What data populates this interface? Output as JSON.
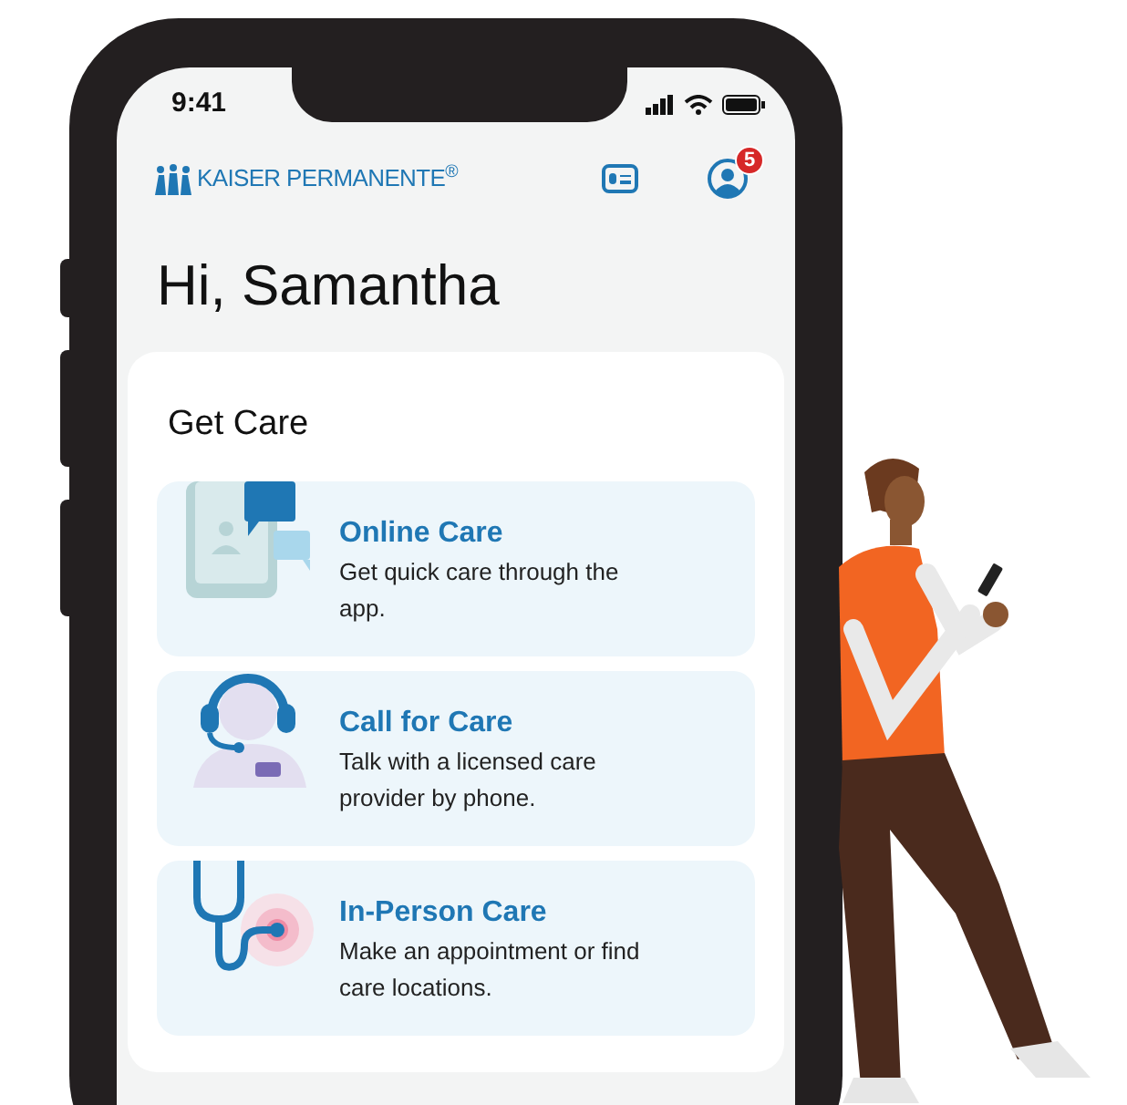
{
  "status_bar": {
    "time": "9:41"
  },
  "header": {
    "logo": "KAISER PERMANENTE$^{®}$",
    "notification_count": "5"
  },
  "greeting": "Hi, Samantha",
  "get_care": {
    "title": "Get Care",
    "items": [
      {
        "kind": "online",
        "title": "Online Care",
        "description": "Get quick care through the app."
      },
      {
        "kind": "call",
        "title": "Call for Care",
        "description": "Talk with a licensed care provider by phone."
      },
      {
        "kind": "in_person",
        "title": "In-Person Care",
        "description": "Make an appointment or find care locations."
      }
    ]
  }
}
